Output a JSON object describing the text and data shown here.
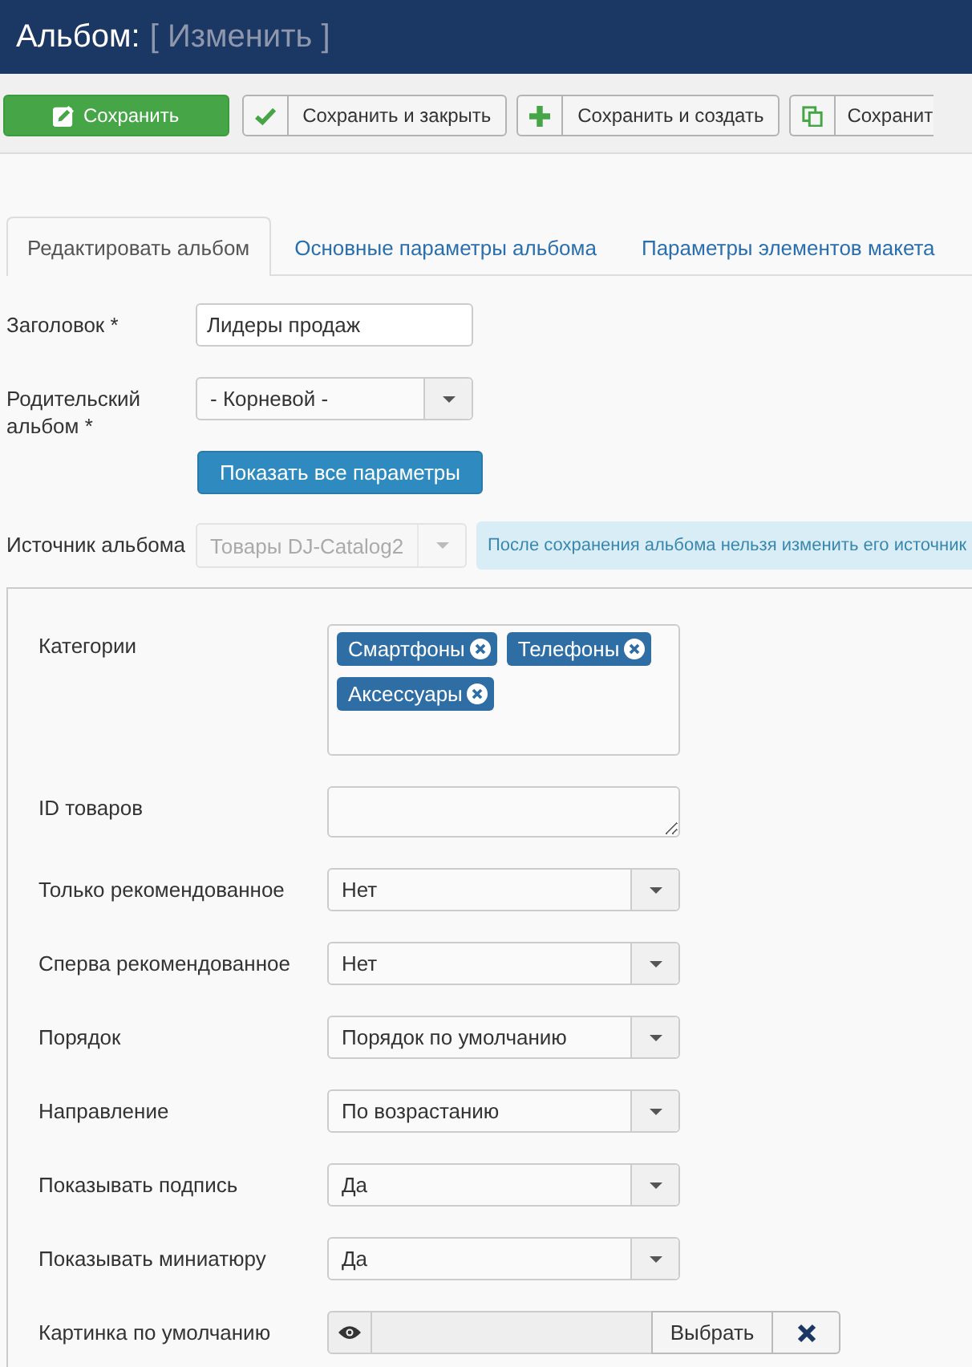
{
  "header": {
    "title": "Альбом:",
    "subtitle": "[ Изменить ]"
  },
  "toolbar": [
    {
      "label": "Сохранить",
      "kind": "primary"
    },
    {
      "label": "Сохранить и закрыть",
      "kind": "default"
    },
    {
      "label": "Сохранить и создать",
      "kind": "default"
    },
    {
      "label": "Сохранит",
      "kind": "default"
    }
  ],
  "tabs": [
    {
      "label": "Редактировать альбом",
      "selected": true
    },
    {
      "label": "Основные параметры альбома",
      "selected": false
    },
    {
      "label": "Параметры элементов макета",
      "selected": false
    }
  ],
  "fields": [
    {
      "kind": "text",
      "label": "Заголовок *",
      "value": "Лидеры продаж",
      "disabled": false
    },
    {
      "kind": "select",
      "label": "Родительский альбом *",
      "value": "- Корневой -",
      "disabled": false
    },
    {
      "kind": "button",
      "label": "Показать все параметры",
      "disabled": false
    },
    {
      "kind": "select",
      "label": "Источник альбома",
      "value": "Товары DJ-Catalog2",
      "disabled": true,
      "note": "После сохранения альбома нельзя изменить его источник"
    }
  ],
  "params": [
    {
      "kind": "tags",
      "label": "Категории",
      "tags": [
        "Смартфоны",
        "Телефоны",
        "Аксессуары"
      ]
    },
    {
      "kind": "textarea",
      "label": "ID товаров"
    },
    {
      "kind": "select",
      "label": "Только рекомендованное",
      "value": "Нет"
    },
    {
      "kind": "select",
      "label": "Сперва рекомендованное",
      "value": "Нет"
    },
    {
      "kind": "select",
      "label": "Порядок",
      "value": "Порядок по умолчанию"
    },
    {
      "kind": "select",
      "label": "Направление",
      "value": "По возрастанию"
    },
    {
      "kind": "select",
      "label": "Показывать подпись",
      "value": "Да"
    },
    {
      "kind": "select",
      "label": "Показывать миниатюру",
      "value": "Да"
    },
    {
      "kind": "media",
      "label": "Картинка по умолчанию",
      "button": "Выбрать"
    }
  ]
}
